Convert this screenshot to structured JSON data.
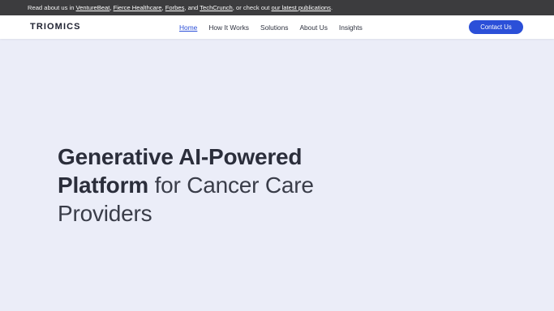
{
  "announcement": {
    "prefix": "Read about us in ",
    "link_venturebeat": "VentureBeat",
    "sep1": ", ",
    "link_fierce": "Fierce Healthcare",
    "sep2": ", ",
    "link_forbes": "Forbes",
    "sep3": ", and ",
    "link_techcrunch": "TechCrunch",
    "middle": ", or check out ",
    "link_publications": "our latest publications",
    "suffix": "."
  },
  "navbar": {
    "logo": "TRIOMICS",
    "links": [
      "Home",
      "How It Works",
      "Solutions",
      "About Us",
      "Insights"
    ],
    "active": "Home",
    "contact_label": "Contact Us"
  },
  "hero": {
    "headline_bold": "Generative AI-Powered Platform",
    "headline_light": " for Cancer Care Providers"
  },
  "colors": {
    "accent": "#2b4fd8",
    "announcement_bg": "#3c3c3e",
    "page_bg": "#ebedf8"
  }
}
